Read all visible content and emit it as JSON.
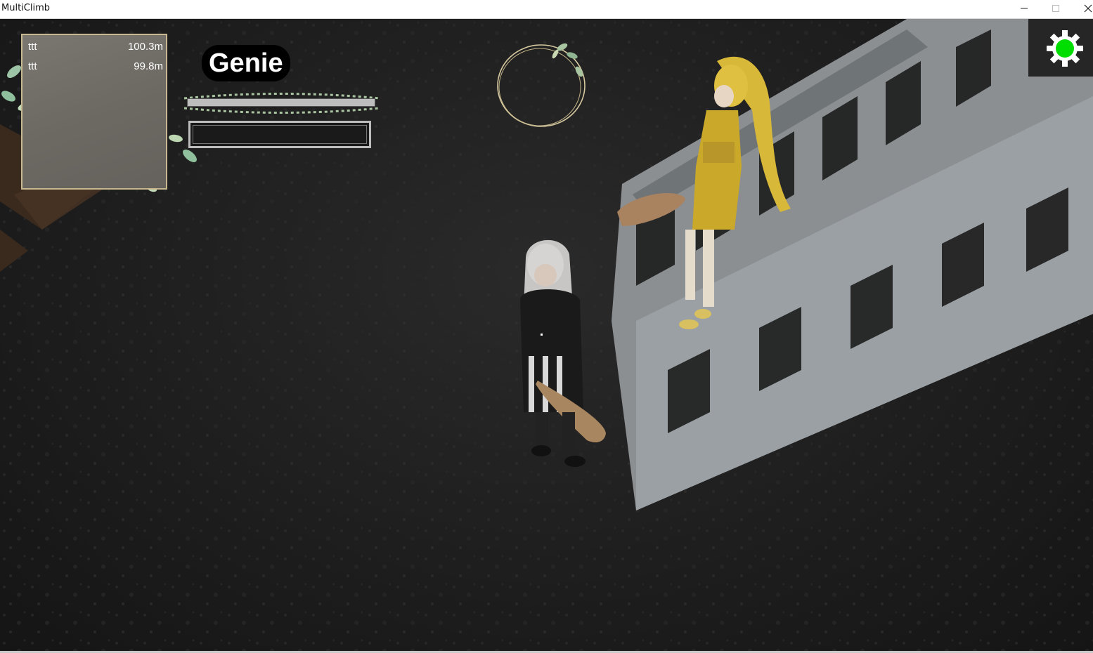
{
  "window": {
    "title": "MultiClimb",
    "minimize_icon": "minimize-icon",
    "maximize_icon": "maximize-icon",
    "close_icon": "close-icon"
  },
  "hud": {
    "leaderboard": [
      {
        "name": "ttt",
        "distance": "100.3m"
      },
      {
        "name": "ttt",
        "distance": "99.8m"
      }
    ],
    "player_name": "Genie",
    "settings_icon": "gear-icon",
    "status_color": "#00dd00",
    "accent_color": "#c8b890"
  }
}
